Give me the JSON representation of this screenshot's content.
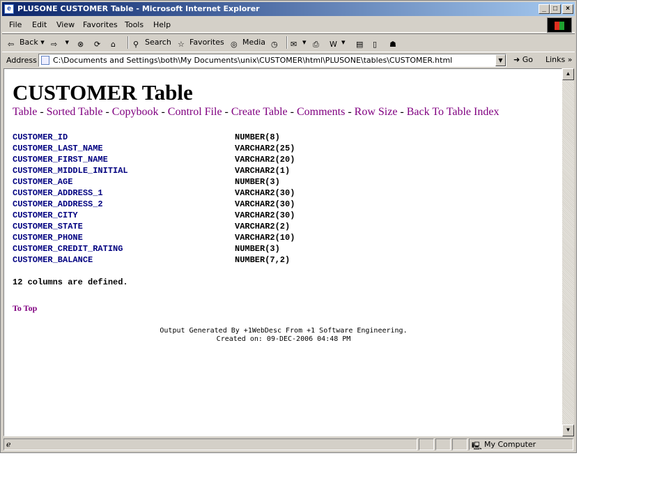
{
  "window": {
    "title": "PLUSONE CUSTOMER Table - Microsoft Internet Explorer"
  },
  "menu": {
    "file": "File",
    "edit": "Edit",
    "view": "View",
    "favorites": "Favorites",
    "tools": "Tools",
    "help": "Help"
  },
  "toolbar": {
    "back": "Back",
    "search": "Search",
    "favorites": "Favorites",
    "media": "Media"
  },
  "address": {
    "label": "Address",
    "url": "C:\\Documents and Settings\\both\\My Documents\\unix\\CUSTOMER\\html\\PLUSONE\\tables\\CUSTOMER.html",
    "go": "Go",
    "links": "Links"
  },
  "page": {
    "heading": "CUSTOMER Table",
    "nav": [
      "Table",
      "Sorted Table",
      "Copybook",
      "Control File",
      "Create Table",
      "Comments",
      "Row Size",
      "Back To Table Index"
    ],
    "nav_separator": " - ",
    "columns": [
      {
        "name": "CUSTOMER_ID",
        "type": "NUMBER(8)"
      },
      {
        "name": "CUSTOMER_LAST_NAME",
        "type": "VARCHAR2(25)"
      },
      {
        "name": "CUSTOMER_FIRST_NAME",
        "type": "VARCHAR2(20)"
      },
      {
        "name": "CUSTOMER_MIDDLE_INITIAL",
        "type": "VARCHAR2(1)"
      },
      {
        "name": "CUSTOMER_AGE",
        "type": "NUMBER(3)"
      },
      {
        "name": "CUSTOMER_ADDRESS_1",
        "type": "VARCHAR2(30)"
      },
      {
        "name": "CUSTOMER_ADDRESS_2",
        "type": "VARCHAR2(30)"
      },
      {
        "name": "CUSTOMER_CITY",
        "type": "VARCHAR2(30)"
      },
      {
        "name": "CUSTOMER_STATE",
        "type": "VARCHAR2(2)"
      },
      {
        "name": "CUSTOMER_PHONE",
        "type": "VARCHAR2(10)"
      },
      {
        "name": "CUSTOMER_CREDIT_RATING",
        "type": "NUMBER(3)"
      },
      {
        "name": "CUSTOMER_BALANCE",
        "type": "NUMBER(7,2)"
      }
    ],
    "defined_text": "12 columns are defined.",
    "to_top": "To Top",
    "footer_line1": "Output Generated By +1WebDesc From +1 Software Engineering.",
    "footer_line2": "Created on: 09-DEC-2006 04:48 PM"
  },
  "status": {
    "zone": "My Computer"
  },
  "colors": {
    "link_visited": "#800080",
    "column_name": "#000080",
    "title_bar_start": "#0a246a",
    "title_bar_end": "#a6caf0"
  }
}
